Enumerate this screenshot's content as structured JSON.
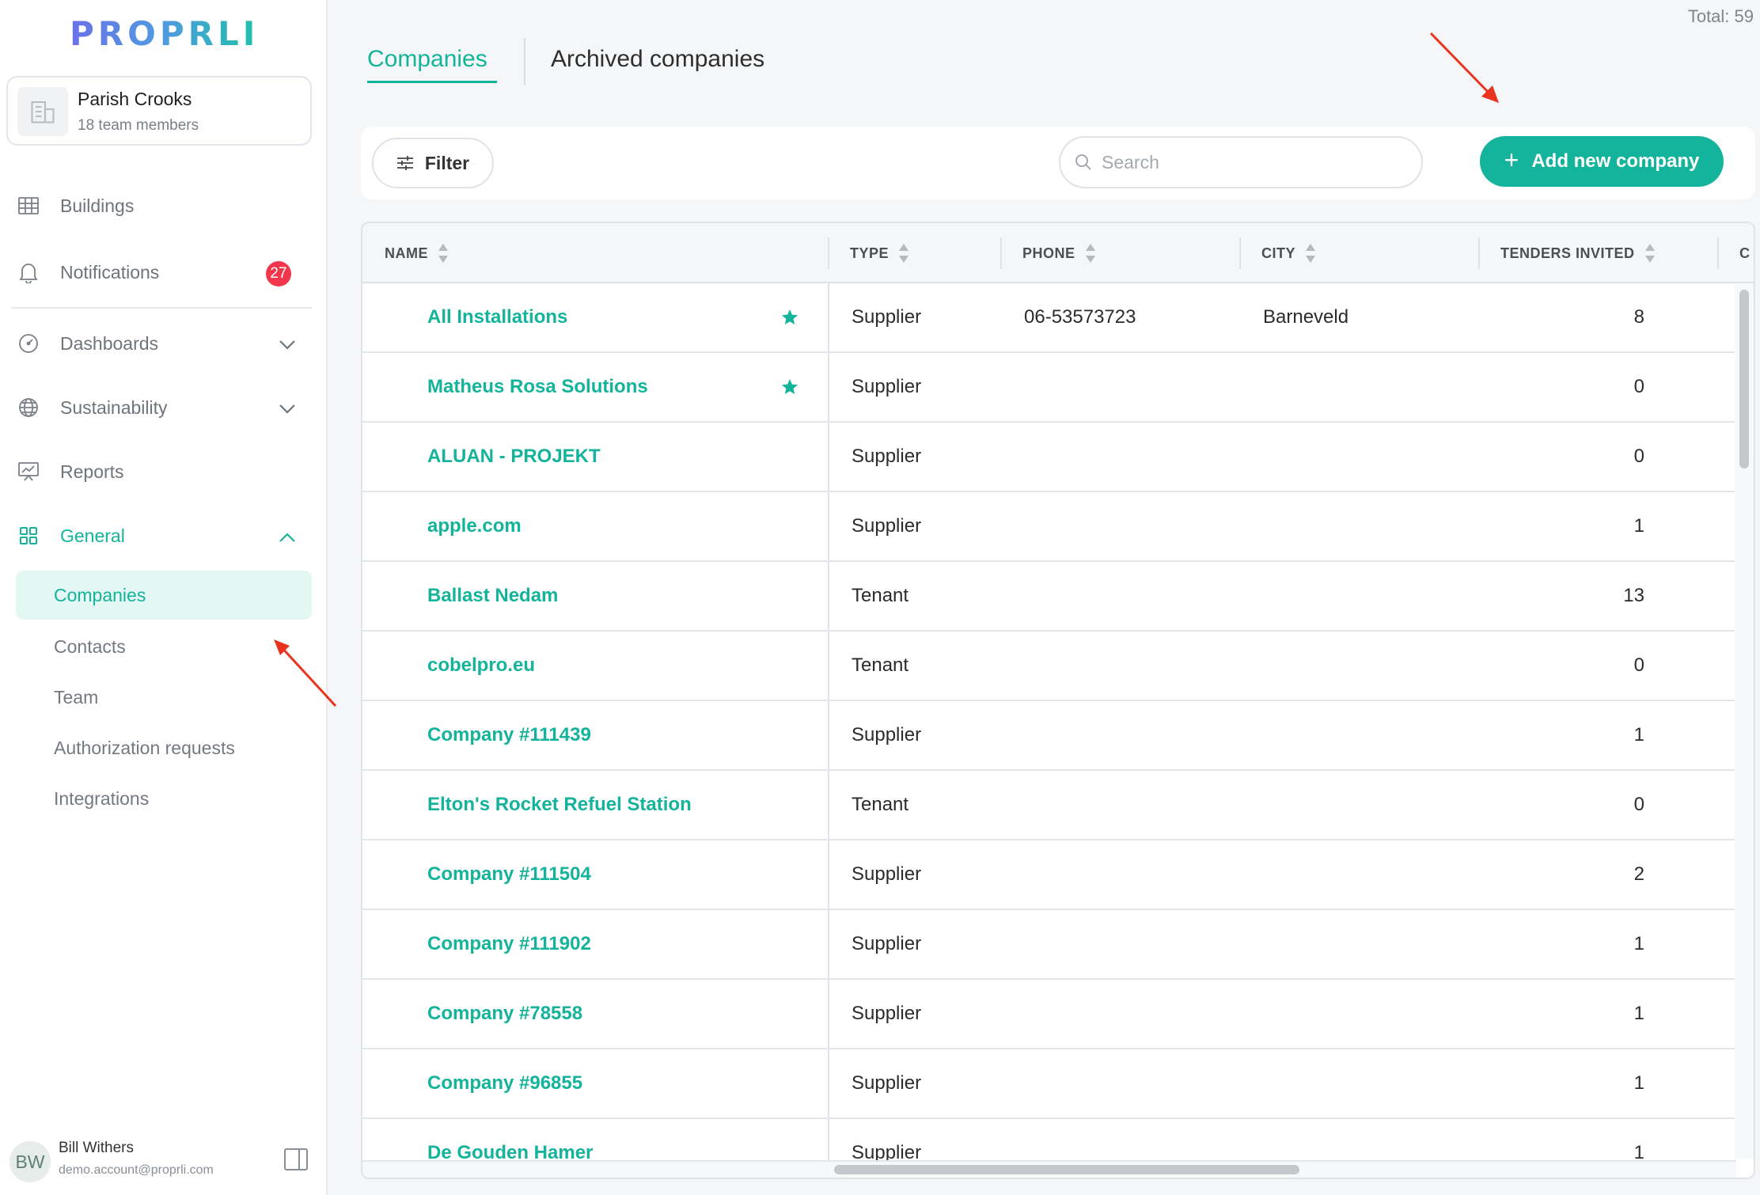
{
  "brand": {
    "logo": "PROPRLI",
    "accent": "#14b39b",
    "logo_gradient": [
      "#6a72e8",
      "#4f9be0",
      "#1fc0a8"
    ]
  },
  "account": {
    "name": "Parish Crooks",
    "subtitle": "18 team members",
    "icon": "building-icon"
  },
  "sidebar": {
    "items": [
      {
        "label": "Buildings",
        "icon": "grid-table-icon"
      },
      {
        "label": "Notifications",
        "icon": "bell-icon",
        "badge": "27"
      },
      {
        "label": "Dashboards",
        "icon": "gauge-icon",
        "expandable": true
      },
      {
        "label": "Sustainability",
        "icon": "globe-icon",
        "expandable": true
      },
      {
        "label": "Reports",
        "icon": "presentation-chart-icon"
      },
      {
        "label": "General",
        "icon": "apps-grid-icon",
        "expanded": true
      }
    ],
    "general_subitems": [
      {
        "label": "Companies",
        "active": true
      },
      {
        "label": "Contacts"
      },
      {
        "label": "Team"
      },
      {
        "label": "Authorization requests"
      },
      {
        "label": "Integrations"
      }
    ]
  },
  "user": {
    "initials": "BW",
    "name": "Bill Withers",
    "email": "demo.account@proprli.com"
  },
  "header": {
    "total": "Total: 59",
    "tabs": [
      {
        "label": "Companies",
        "active": true
      },
      {
        "label": "Archived companies",
        "active": false
      }
    ]
  },
  "toolbar": {
    "filter_label": "Filter",
    "search_placeholder": "Search",
    "search_value": "",
    "add_label": "Add new company"
  },
  "table": {
    "columns": [
      "NAME",
      "TYPE",
      "PHONE",
      "CITY",
      "TENDERS INVITED",
      "C"
    ],
    "rows": [
      {
        "name": "All Installations",
        "starred": true,
        "type": "Supplier",
        "phone": "06-53573723",
        "city": "Barneveld",
        "tenders": "8"
      },
      {
        "name": "Matheus Rosa Solutions",
        "starred": true,
        "type": "Supplier",
        "phone": "",
        "city": "",
        "tenders": "0"
      },
      {
        "name": "ALUAN - PROJEKT",
        "starred": false,
        "type": "Supplier",
        "phone": "",
        "city": "",
        "tenders": "0"
      },
      {
        "name": "apple.com",
        "starred": false,
        "type": "Supplier",
        "phone": "",
        "city": "",
        "tenders": "1"
      },
      {
        "name": "Ballast Nedam",
        "starred": false,
        "type": "Tenant",
        "phone": "",
        "city": "",
        "tenders": "13"
      },
      {
        "name": "cobelpro.eu",
        "starred": false,
        "type": "Tenant",
        "phone": "",
        "city": "",
        "tenders": "0"
      },
      {
        "name": "Company #111439",
        "starred": false,
        "type": "Supplier",
        "phone": "",
        "city": "",
        "tenders": "1"
      },
      {
        "name": "Elton's Rocket Refuel Station",
        "starred": false,
        "type": "Tenant",
        "phone": "",
        "city": "",
        "tenders": "0"
      },
      {
        "name": "Company #111504",
        "starred": false,
        "type": "Supplier",
        "phone": "",
        "city": "",
        "tenders": "2"
      },
      {
        "name": "Company #111902",
        "starred": false,
        "type": "Supplier",
        "phone": "",
        "city": "",
        "tenders": "1"
      },
      {
        "name": "Company #78558",
        "starred": false,
        "type": "Supplier",
        "phone": "",
        "city": "",
        "tenders": "1"
      },
      {
        "name": "Company #96855",
        "starred": false,
        "type": "Supplier",
        "phone": "",
        "city": "",
        "tenders": "1"
      },
      {
        "name": "De Gouden Hamer",
        "starred": false,
        "type": "Supplier",
        "phone": "",
        "city": "",
        "tenders": "1"
      }
    ]
  }
}
